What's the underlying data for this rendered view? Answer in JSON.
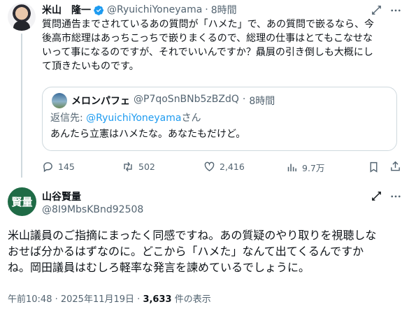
{
  "parent_tweet": {
    "author_name": "米山　隆一",
    "handle": "@RyuichiYoneyama",
    "time_sep": "·",
    "time": "8時間",
    "text_lines": [
      "質問通告までされているあの質問が「ハメた」で、あの質問で嵌るなら、今",
      "後高市総理はあっちこっちで嵌りまくるので、総理の仕事はとてもこなせな",
      "いって事になるのですが、それでいいんですか？贔屓の引き倒しも大概にし",
      "て頂きたいものです。"
    ],
    "quote": {
      "author_name": "メロンパフェ",
      "handle": "@P7qoSnBNb5zBZdQ",
      "time_sep": "·",
      "time": "8時間",
      "reply_prefix": "返信先: ",
      "reply_handle": "@RyuichiYoneyama",
      "reply_suffix": "さん",
      "text": "あんたら立憲はハメたな。あなたもだけど。"
    },
    "actions": {
      "replies": "145",
      "reposts": "502",
      "likes": "2,416",
      "views": "9.7万"
    }
  },
  "main_tweet": {
    "avatar_text": "賢量",
    "author_name": "山谷賢量",
    "handle": "@8I9MbsKBnd92508",
    "text_lines": [
      "米山議員のご指摘にまったく同感ですね。あの質疑のやり取りを視聴しな",
      "おせば分かるはずなのに。どこから「ハメた」なんて出てくるんですか",
      "ね。岡田議員はむしろ軽率な発言を諫めているでしょうに。"
    ],
    "timestamp": "午前10:48 · 2025年11月19日 · ",
    "view_count": "3,633",
    "view_suffix": " 件の表示"
  },
  "colors": {
    "text": "#0f1419",
    "muted": "#536471",
    "verified": "#1d9bf0",
    "border": "#cfd9de",
    "avatar_green": "#1f6b46"
  },
  "icons": [
    "verified-badge-icon",
    "grok-icon",
    "more-icon",
    "reply-icon",
    "repost-icon",
    "like-icon",
    "views-icon",
    "bookmark-icon",
    "share-icon"
  ]
}
